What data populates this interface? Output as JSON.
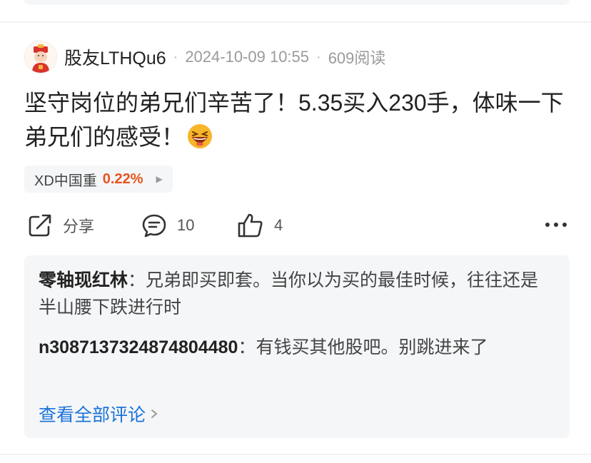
{
  "post": {
    "username": "股友LTHQu6",
    "datetime": "2024-10-09 10:55",
    "reads": "609阅读",
    "text": "坚守岗位的弟兄们辛苦了！5.35买入230手，体味一下弟兄们的感受！",
    "emoji": "laughing-emoji"
  },
  "stock": {
    "name": "XD中国重",
    "change": "0.22%",
    "change_color": "#e8541e"
  },
  "actions": {
    "share_label": "分享",
    "comment_count": "10",
    "like_count": "4"
  },
  "comments": [
    {
      "name": "零轴现红林",
      "separator": "：",
      "text": "兄弟即买即套。当你以为买的最佳时候，往往还是半山腰下跌进行时"
    },
    {
      "name": "n3087137324874804480",
      "separator": "：",
      "text": "有钱买其他股吧。别跳进来了"
    }
  ],
  "view_all_label": "查看全部评论",
  "accent_color": "#1a73d9"
}
